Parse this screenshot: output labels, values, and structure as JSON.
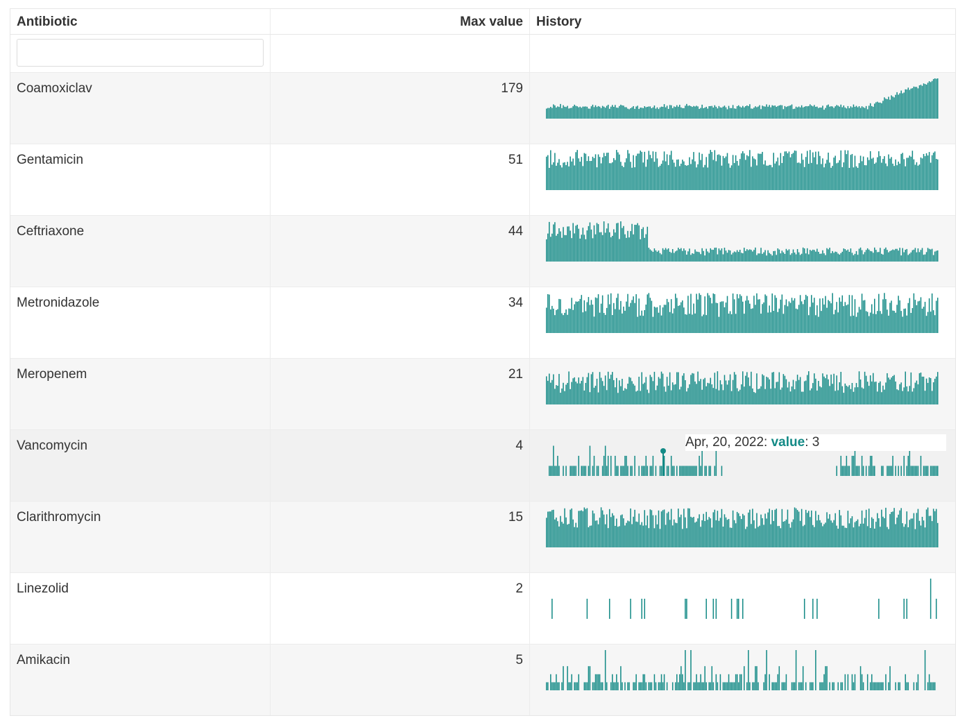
{
  "table": {
    "headers": {
      "name": "Antibiotic",
      "max": "Max value",
      "history": "History"
    },
    "filter": {
      "value": "",
      "placeholder": ""
    },
    "accent_color": "#138a86",
    "rows": [
      {
        "name": "Coamoxiclav",
        "max": "179",
        "max_value": 179,
        "pattern": "rise-end",
        "striped": true
      },
      {
        "name": "Gentamicin",
        "max": "51",
        "max_value": 51,
        "pattern": "dense-high",
        "striped": false
      },
      {
        "name": "Ceftriaxone",
        "max": "44",
        "max_value": 44,
        "pattern": "drop-early",
        "striped": true
      },
      {
        "name": "Metronidazole",
        "max": "34",
        "max_value": 34,
        "pattern": "dense-mid",
        "striped": false
      },
      {
        "name": "Meropenem",
        "max": "21",
        "max_value": 21,
        "pattern": "dense-low",
        "striped": true
      },
      {
        "name": "Vancomycin",
        "max": "4",
        "max_value": 4,
        "pattern": "sparse-gap",
        "striped": false,
        "hovered": true,
        "tooltip": {
          "date": "Apr, 20, 2022",
          "label": "value",
          "value": "3"
        }
      },
      {
        "name": "Clarithromycin",
        "max": "15",
        "max_value": 15,
        "pattern": "dense-mid2",
        "striped": true
      },
      {
        "name": "Linezolid",
        "max": "2",
        "max_value": 2,
        "pattern": "very-sparse",
        "striped": false
      },
      {
        "name": "Amikacin",
        "max": "5",
        "max_value": 5,
        "pattern": "sparse-low",
        "striped": true
      }
    ]
  }
}
